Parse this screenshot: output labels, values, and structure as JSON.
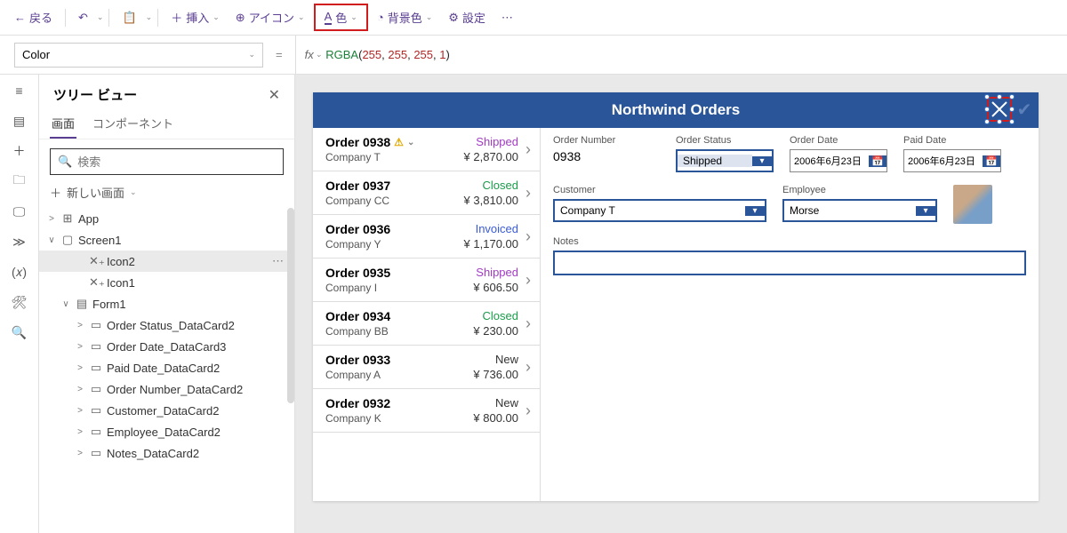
{
  "toolbar": {
    "back": "戻る",
    "insert": "挿入",
    "icon": "アイコン",
    "color": "色",
    "bgcolor": "背景色",
    "settings": "設定"
  },
  "property": {
    "name": "Color",
    "formula_fn": "RGBA",
    "formula_args": [
      "255",
      "255",
      "255",
      "1"
    ]
  },
  "tree": {
    "title": "ツリー ビュー",
    "tab_screen": "画面",
    "tab_component": "コンポーネント",
    "search_placeholder": "検索",
    "new_screen": "新しい画面",
    "items": [
      {
        "indent": 0,
        "chev": ">",
        "ico": "⊞",
        "label": "App"
      },
      {
        "indent": 0,
        "chev": "∨",
        "ico": "▢",
        "label": "Screen1"
      },
      {
        "indent": 2,
        "chev": "",
        "ico": "✕₊",
        "label": "Icon2",
        "selected": true,
        "more": true
      },
      {
        "indent": 2,
        "chev": "",
        "ico": "✕₊",
        "label": "Icon1"
      },
      {
        "indent": 1,
        "chev": "∨",
        "ico": "▤",
        "label": "Form1"
      },
      {
        "indent": 2,
        "chev": ">",
        "ico": "▭",
        "label": "Order Status_DataCard2"
      },
      {
        "indent": 2,
        "chev": ">",
        "ico": "▭",
        "label": "Order Date_DataCard3"
      },
      {
        "indent": 2,
        "chev": ">",
        "ico": "▭",
        "label": "Paid Date_DataCard2"
      },
      {
        "indent": 2,
        "chev": ">",
        "ico": "▭",
        "label": "Order Number_DataCard2"
      },
      {
        "indent": 2,
        "chev": ">",
        "ico": "▭",
        "label": "Customer_DataCard2"
      },
      {
        "indent": 2,
        "chev": ">",
        "ico": "▭",
        "label": "Employee_DataCard2"
      },
      {
        "indent": 2,
        "chev": ">",
        "ico": "▭",
        "label": "Notes_DataCard2"
      }
    ]
  },
  "app": {
    "title": "Northwind Orders",
    "orders": [
      {
        "num": "Order 0938",
        "warn": true,
        "company": "Company T",
        "status": "Shipped",
        "scls": "stat-shipped",
        "amount": "¥ 2,870.00"
      },
      {
        "num": "Order 0937",
        "company": "Company CC",
        "status": "Closed",
        "scls": "stat-closed",
        "amount": "¥ 3,810.00"
      },
      {
        "num": "Order 0936",
        "company": "Company Y",
        "status": "Invoiced",
        "scls": "stat-invoiced",
        "amount": "¥ 1,170.00"
      },
      {
        "num": "Order 0935",
        "company": "Company I",
        "status": "Shipped",
        "scls": "stat-shipped",
        "amount": "¥ 606.50"
      },
      {
        "num": "Order 0934",
        "company": "Company BB",
        "status": "Closed",
        "scls": "stat-closed",
        "amount": "¥ 230.00"
      },
      {
        "num": "Order 0933",
        "company": "Company A",
        "status": "New",
        "scls": "stat-new",
        "amount": "¥ 736.00"
      },
      {
        "num": "Order 0932",
        "company": "Company K",
        "status": "New",
        "scls": "stat-new",
        "amount": "¥ 800.00"
      }
    ],
    "detail": {
      "order_number_label": "Order Number",
      "order_number": "0938",
      "order_status_label": "Order Status",
      "order_status": "Shipped",
      "order_date_label": "Order Date",
      "order_date": "2006年6月23日",
      "paid_date_label": "Paid Date",
      "paid_date": "2006年6月23日",
      "customer_label": "Customer",
      "customer": "Company T",
      "employee_label": "Employee",
      "employee": "Morse",
      "notes_label": "Notes"
    }
  }
}
